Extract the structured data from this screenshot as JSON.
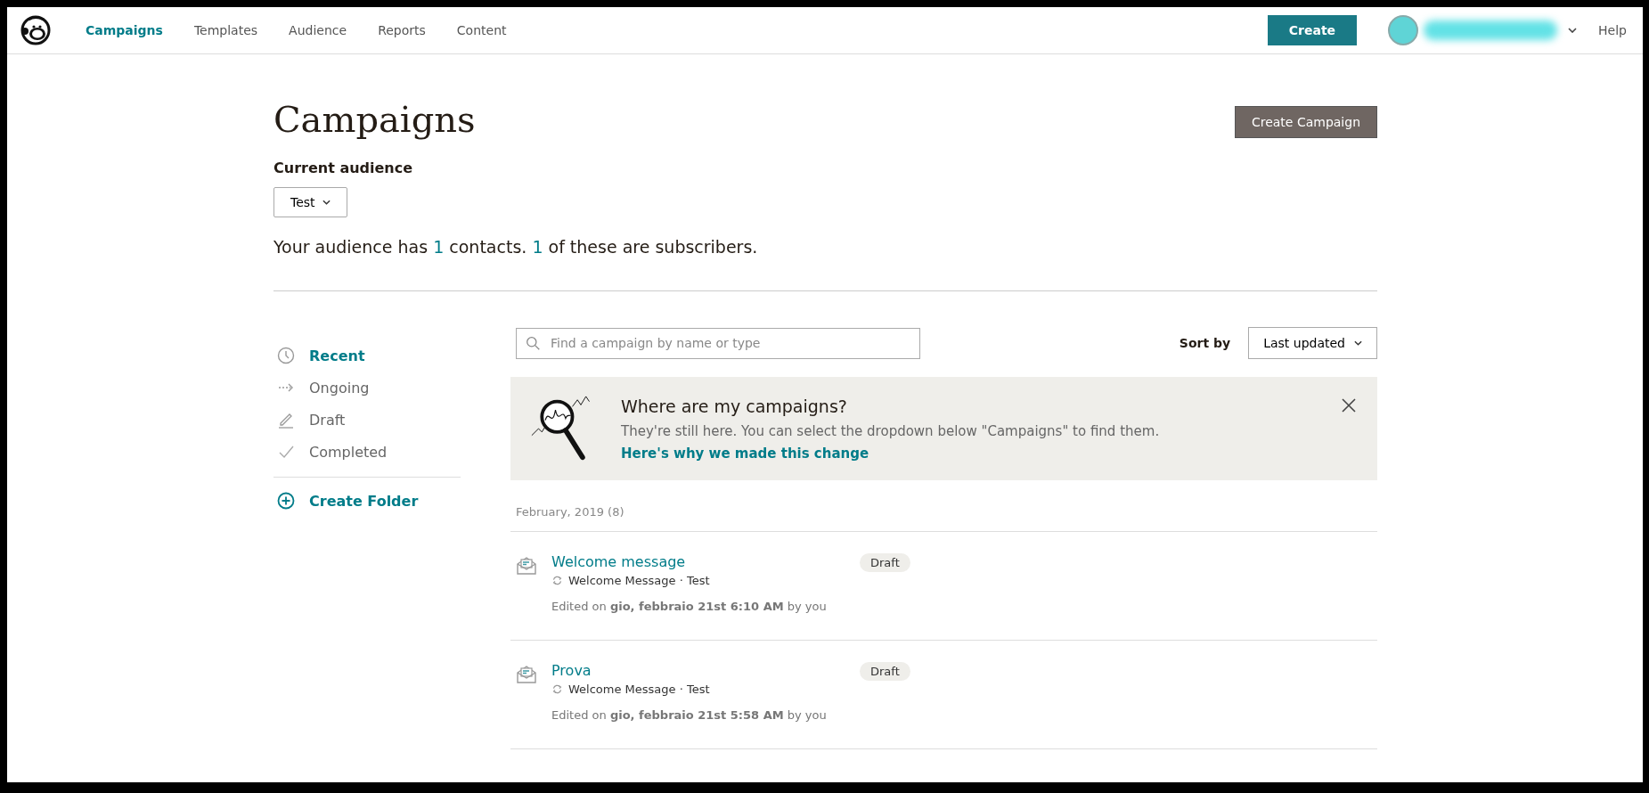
{
  "nav": {
    "tabs": [
      {
        "label": "Campaigns",
        "selected": true
      },
      {
        "label": "Templates",
        "selected": false
      },
      {
        "label": "Audience",
        "selected": false
      },
      {
        "label": "Reports",
        "selected": false
      },
      {
        "label": "Content",
        "selected": false
      }
    ],
    "create": "Create",
    "help": "Help"
  },
  "header": {
    "title": "Campaigns",
    "create_campaign": "Create Campaign",
    "audience_label": "Current audience",
    "audience_value": "Test",
    "summary": "Your audience has **1** contacts. **1** of these are subscribers."
  },
  "sidebar": {
    "items": [
      {
        "kind": "clock",
        "label": "Recent",
        "selected": true
      },
      {
        "kind": "arrow",
        "label": "Ongoing",
        "selected": false
      },
      {
        "kind": "pencil",
        "label": "Draft",
        "selected": false
      },
      {
        "kind": "check",
        "label": "Completed",
        "selected": false
      }
    ],
    "create_folder": "Create Folder"
  },
  "search": {
    "placeholder": "Find a campaign by name or type"
  },
  "sort": {
    "label": "Sort by",
    "value": "Last updated"
  },
  "banner": {
    "title": "Where are my campaigns?",
    "text": "They're still here. You can select the dropdown below \"Campaigns\" to find them.",
    "link": "Here's why we made this change"
  },
  "group": {
    "heading": "February, 2019 (8)",
    "campaigns": [
      {
        "name": "Welcome message",
        "type": "Welcome Message · Test",
        "edited": "Edited on **gio, febbraio 21st 6:10 AM** by you",
        "status": "Draft"
      },
      {
        "name": "Prova",
        "type": "Welcome Message · Test",
        "edited": "Edited on **gio, febbraio 21st 5:58 AM** by you",
        "status": "Draft"
      }
    ]
  }
}
